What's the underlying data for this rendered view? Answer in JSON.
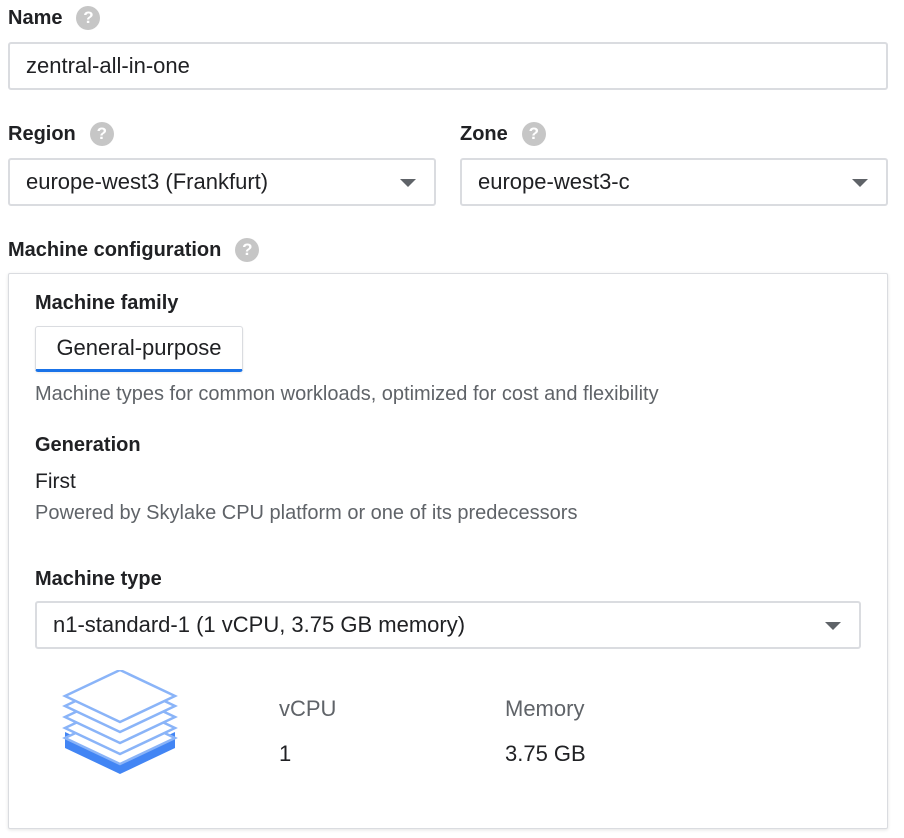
{
  "name_section": {
    "label": "Name",
    "help": "?",
    "value": "zentral-all-in-one"
  },
  "region_section": {
    "label": "Region",
    "help": "?",
    "value": "europe-west3 (Frankfurt)"
  },
  "zone_section": {
    "label": "Zone",
    "help": "?",
    "value": "europe-west3-c"
  },
  "machine_config": {
    "label": "Machine configuration",
    "help": "?",
    "family_label": "Machine family",
    "family_button": "General-purpose",
    "family_desc": "Machine types for common workloads, optimized for cost and flexibility",
    "generation_label": "Generation",
    "generation_value": "First",
    "generation_desc": "Powered by Skylake CPU platform or one of its predecessors",
    "type_label": "Machine type",
    "type_value": "n1-standard-1 (1 vCPU, 3.75 GB memory)",
    "vcpu_label": "vCPU",
    "vcpu_value": "1",
    "memory_label": "Memory",
    "memory_value": "3.75 GB"
  },
  "icons": {
    "help": "question-circle-icon",
    "dropdown": "caret-down-icon",
    "machine": "stacked-layers-icon"
  },
  "colors": {
    "accent": "#1a73e8",
    "help_icon": "#c6c6c6",
    "layer_stroke": "#8ab4f8",
    "layer_base": "#4285f4"
  }
}
